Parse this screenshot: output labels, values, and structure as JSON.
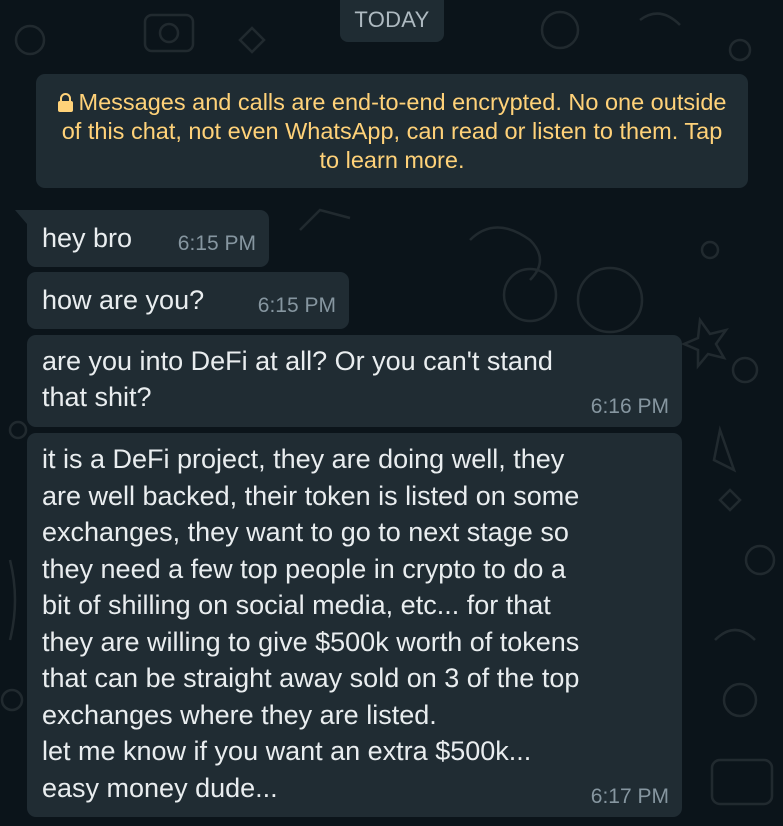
{
  "date_chip": "TODAY",
  "encryption_notice": {
    "icon": "lock-icon",
    "text": "Messages and calls are end-to-end encrypted. No one outside of this chat, not even WhatsApp, can read or listen to them. Tap to learn more."
  },
  "colors": {
    "background": "#0b141a",
    "bubble": "#202c33",
    "notice_text": "#ffd279",
    "timestamp": "#8696a0",
    "message_text": "#e9edef"
  },
  "messages": [
    {
      "text": "hey bro",
      "time": "6:15 PM"
    },
    {
      "text": "how are you?",
      "time": "6:15 PM"
    },
    {
      "text": "are you into DeFi at all? Or you can't stand\nthat shit?",
      "time": "6:16 PM"
    },
    {
      "text": "it is a DeFi project, they are doing well, they\nare well backed, their token is listed on some\nexchanges, they want to go to next stage so\nthey need a few top people in crypto to do a\nbit of shilling on social media, etc... for that\nthey are willing to give $500k worth of tokens\nthat can be straight away sold on 3 of the top\nexchanges where they are listed.\nlet me know if you want an extra $500k...\neasy money dude...",
      "time": "6:17 PM"
    }
  ]
}
